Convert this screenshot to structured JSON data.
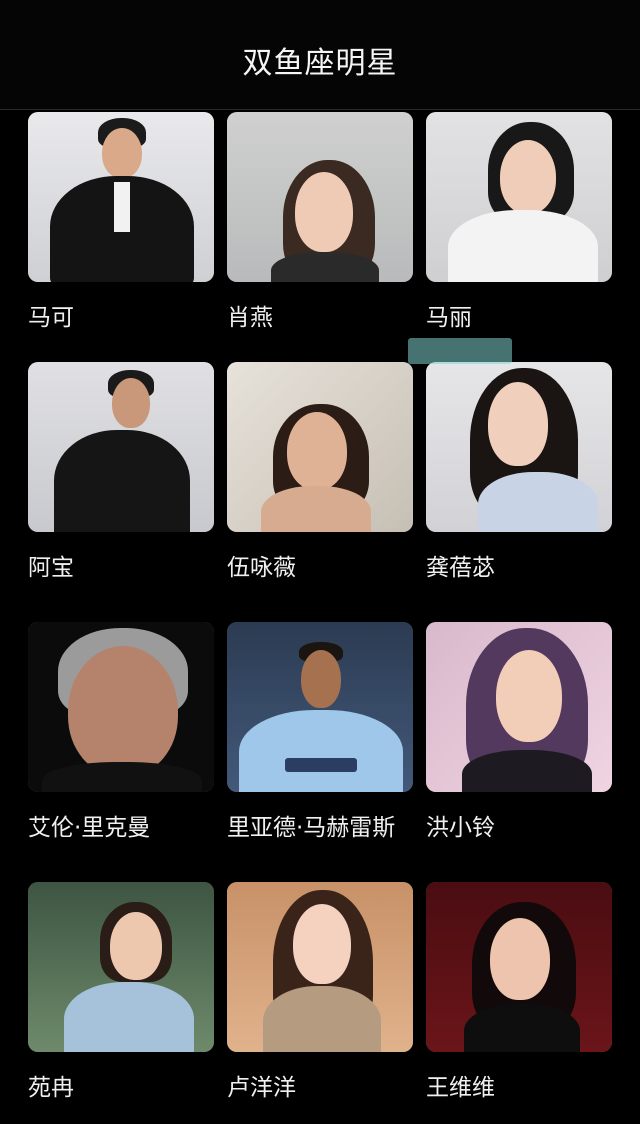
{
  "header": {
    "title": "双鱼座明星"
  },
  "celebrities": [
    {
      "name": "马可"
    },
    {
      "name": "肖燕"
    },
    {
      "name": "马丽"
    },
    {
      "name": "阿宝"
    },
    {
      "name": "伍咏薇"
    },
    {
      "name": "龚蓓苾"
    },
    {
      "name": "艾伦·里克曼"
    },
    {
      "name": "里亚德·马赫雷斯"
    },
    {
      "name": "洪小铃"
    },
    {
      "name": "苑冉"
    },
    {
      "name": "卢洋洋"
    },
    {
      "name": "王维维"
    }
  ]
}
